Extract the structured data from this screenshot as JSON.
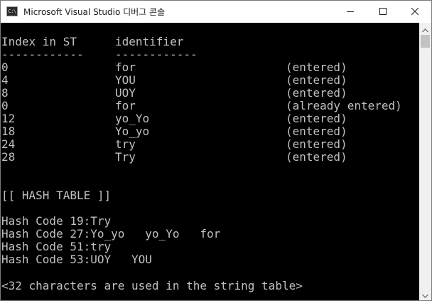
{
  "window": {
    "title": "Microsoft Visual Studio 디버그 콘솔",
    "icon_text": "C:\\"
  },
  "console": {
    "dashes_left": "------------",
    "dashes_right": "------------",
    "header": {
      "col1": "Index in ST",
      "col2": "identifier"
    },
    "rows": [
      {
        "index": "0",
        "identifier": "for",
        "status": "(entered)"
      },
      {
        "index": "4",
        "identifier": "YOU",
        "status": "(entered)"
      },
      {
        "index": "8",
        "identifier": "UOY",
        "status": "(entered)"
      },
      {
        "index": "0",
        "identifier": "for",
        "status": "(already entered)"
      },
      {
        "index": "12",
        "identifier": "yo_Yo",
        "status": "(entered)"
      },
      {
        "index": "18",
        "identifier": "Yo_yo",
        "status": "(entered)"
      },
      {
        "index": "24",
        "identifier": "try",
        "status": "(entered)"
      },
      {
        "index": "28",
        "identifier": "Try",
        "status": "(entered)"
      }
    ],
    "hash_table_title": "[[ HASH TABLE ]]",
    "hash_lines": [
      "Hash Code 19:Try",
      "Hash Code 27:Yo_yo   yo_Yo   for",
      "Hash Code 51:try",
      "Hash Code 53:UOY   YOU"
    ],
    "summary": "<32 characters are used in the string table>"
  },
  "icons": {
    "minimize": "minimize-icon",
    "maximize": "maximize-icon",
    "close": "close-icon",
    "app": "console-app-icon"
  }
}
